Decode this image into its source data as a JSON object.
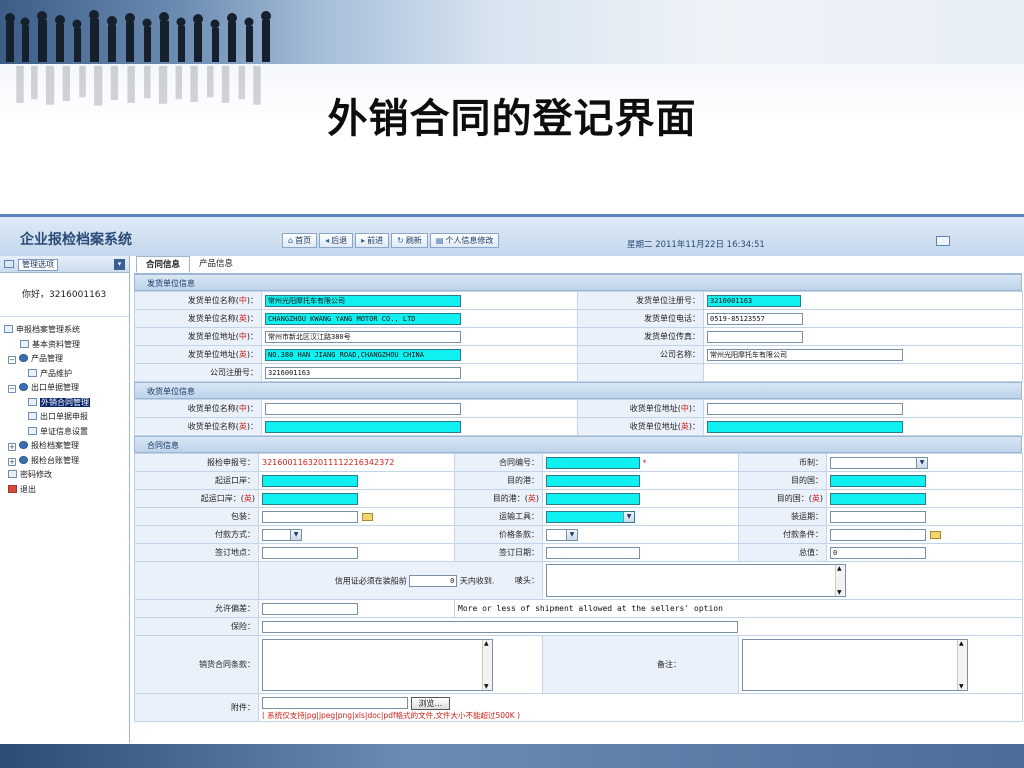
{
  "slide": {
    "title": "外销合同的登记界面"
  },
  "app": {
    "name": "企业报检档案系统",
    "nav": [
      {
        "glyph": "⌂",
        "label": "首页"
      },
      {
        "glyph": "◂",
        "label": "后退"
      },
      {
        "glyph": "▸",
        "label": "前进"
      },
      {
        "glyph": "↻",
        "label": "刷新"
      },
      {
        "glyph": "▤",
        "label": "个人信息修改"
      }
    ],
    "datetime": "星期二 2011年11月22日 16:34:51"
  },
  "sidebar": {
    "header_label": "管理选项",
    "greeting": "你好，3216001163",
    "tree": [
      {
        "label": "申报档案管理系统",
        "level": 0,
        "icon": "root"
      },
      {
        "label": "基本资料管理",
        "level": 1,
        "icon": "page"
      },
      {
        "label": "产品管理",
        "level": 1,
        "icon": "circle",
        "expander": "−"
      },
      {
        "label": "产品维护",
        "level": 2,
        "icon": "page"
      },
      {
        "label": "出口单据管理",
        "level": 1,
        "icon": "circle",
        "expander": "−"
      },
      {
        "label": "外销合同管理",
        "level": 2,
        "icon": "page",
        "selected": true
      },
      {
        "label": "出口单据申报",
        "level": 2,
        "icon": "page"
      },
      {
        "label": "单证信息设置",
        "level": 2,
        "icon": "page"
      },
      {
        "label": "报检档案管理",
        "level": 1,
        "icon": "circle",
        "expander": "+"
      },
      {
        "label": "报检台账管理",
        "level": 1,
        "icon": "circle",
        "expander": "+"
      },
      {
        "label": "密码修改",
        "level": 1,
        "icon": "page"
      },
      {
        "label": "退出",
        "level": 1,
        "icon": "exit"
      }
    ]
  },
  "tabs": [
    {
      "label": "合同信息",
      "active": true
    },
    {
      "label": "产品信息",
      "active": false
    }
  ],
  "sender": {
    "title": "发货单位信息",
    "name_cn": {
      "pre": "发货单位名称(",
      "mark": "中",
      "post": ")：",
      "value": "常州光阳摩托车有限公司"
    },
    "reg_no": {
      "label": "发货单位注册号：",
      "value": "3216001163"
    },
    "name_en": {
      "pre": "发货单位名称(",
      "mark": "英",
      "post": ")：",
      "value": "CHANGZHOU KWANG YANG MOTOR CO., LTD"
    },
    "phone": {
      "label": "发货单位电话：",
      "value": "0519-85123557"
    },
    "addr_cn": {
      "pre": "发货单位地址(",
      "mark": "中",
      "post": ")：",
      "value": "常州市新北区汉江路380号"
    },
    "fax": {
      "label": "发货单位传真：",
      "value": ""
    },
    "addr_en": {
      "pre": "发货单位地址(",
      "mark": "英",
      "post": ")：",
      "value": "NO.380 HAN JIANG ROAD,CHANGZHOU CHINA"
    },
    "company": {
      "label": "公司名称：",
      "value": "常州光阳摩托车有限公司"
    },
    "company_reg": {
      "label": "公司注册号：",
      "value": "3216001163"
    }
  },
  "receiver": {
    "title": "收货单位信息",
    "name_cn": {
      "pre": "收货单位名称(",
      "mark": "中",
      "post": ")："
    },
    "addr_cn": {
      "pre": "收货单位地址(",
      "mark": "中",
      "post": ")："
    },
    "name_en": {
      "pre": "收货单位名称(",
      "mark": "英",
      "post": ")："
    },
    "addr_en": {
      "pre": "收货单位地址(",
      "mark": "英",
      "post": ")："
    }
  },
  "contract": {
    "title": "合同信息",
    "report_no": {
      "label": "报检申报号：",
      "value": "32160011632011112216342372"
    },
    "contract_no": {
      "label": "合同编号：",
      "required": "*"
    },
    "currency": {
      "label": "币制："
    },
    "start_port": {
      "label": "起运口岸："
    },
    "dest_port": {
      "label": "目的港："
    },
    "dest_country": {
      "label": "目的国："
    },
    "start_port_en": {
      "pre": "起运口岸：(",
      "mark": "英",
      "post": ")"
    },
    "dest_port_en": {
      "pre": "目的港：(",
      "mark": "英",
      "post": ")"
    },
    "dest_country_en": {
      "pre": "目的国：(",
      "mark": "英",
      "post": ")"
    },
    "packing": {
      "label": "包装："
    },
    "transport": {
      "label": "运输工具："
    },
    "ship_date": {
      "label": "装运期："
    },
    "pay_method": {
      "label": "付款方式："
    },
    "price_terms": {
      "label": "价格条款："
    },
    "pay_terms": {
      "label": "付款条件："
    },
    "sign_place": {
      "label": "签订地点："
    },
    "sign_date": {
      "label": "签订日期："
    },
    "total": {
      "label": "总值：",
      "value": "0"
    },
    "lc": {
      "pre": "信用证必须在装船前",
      "value": "0",
      "post": "天内收到.",
      "mark_label": "唛头："
    },
    "tolerance": {
      "label": "允许偏差：",
      "note": "More or less of shipment allowed at the sellers'  option"
    },
    "insurance": {
      "label": "保险："
    },
    "terms": {
      "label": "销货合同条款："
    },
    "remark": {
      "label": "备注："
    },
    "attach": {
      "label": "附件：",
      "browse": "浏览...",
      "hint": "( 系统仅支持jpg|jpeg|png|xls|doc|pdf格式的文件,文件大小不能超过500K )"
    }
  }
}
